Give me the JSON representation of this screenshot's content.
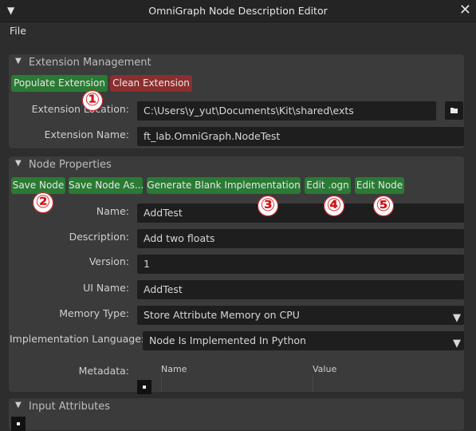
{
  "window": {
    "title": "OmniGraph Node Description Editor"
  },
  "menu": {
    "file": "File"
  },
  "extension_management": {
    "header": "Extension Management",
    "populate_button": "Populate Extension",
    "clean_button": "Clean Extension",
    "location_label": "Extension Location:",
    "location_value": "C:\\Users\\y_yut\\Documents\\Kit\\shared\\exts",
    "name_label": "Extension Name:",
    "name_value": "ft_lab.OmniGraph.NodeTest"
  },
  "node_properties": {
    "header": "Node Properties",
    "buttons": {
      "save_node": "Save Node",
      "save_node_as": "Save Node As...",
      "generate_blank": "Generate Blank Implementation",
      "edit_ogn": "Edit .ogn",
      "edit_node": "Edit Node"
    },
    "name_label": "Name:",
    "name_value": "AddTest",
    "description_label": "Description:",
    "description_value": "Add two floats",
    "version_label": "Version:",
    "version_value": "1",
    "ui_name_label": "UI Name:",
    "ui_name_value": "AddTest",
    "memory_type_label": "Memory Type:",
    "memory_type_value": "Store Attribute Memory on CPU",
    "impl_lang_label": "Implementation Language:",
    "impl_lang_value": "Node Is Implemented In Python",
    "metadata_label": "Metadata:",
    "metadata_columns": [
      "Name",
      "Value"
    ]
  },
  "input_attributes": {
    "header": "Input Attributes"
  },
  "annotations": [
    "①",
    "②",
    "③",
    "④",
    "⑤"
  ],
  "colors": {
    "green_button": "#2a7a34",
    "red_button": "#8c2e2e",
    "annotation": "#d4131a"
  }
}
